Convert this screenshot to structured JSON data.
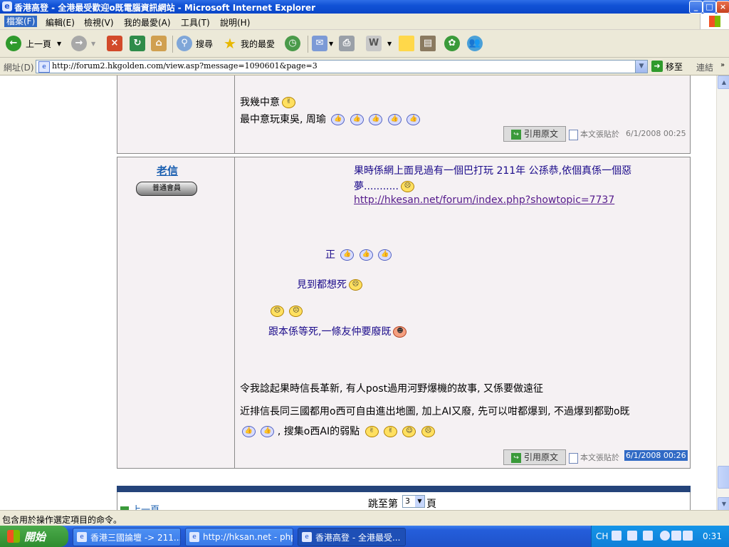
{
  "window": {
    "title": "香港高登 - 全港最受歡迎o既電腦資訊網站 - Microsoft Internet Explorer",
    "controls": [
      "_",
      "□",
      "×"
    ]
  },
  "menu": {
    "items": [
      "檔案(F)",
      "編輯(E)",
      "檢視(V)",
      "我的最愛(A)",
      "工具(T)",
      "說明(H)"
    ]
  },
  "toolbar": {
    "back_label": "上一頁",
    "search_label": "搜尋",
    "favorites_label": "我的最愛"
  },
  "address": {
    "label": "網址(D)",
    "url": "http://forum2.hkgolden.com/view.asp?message=1090601&page=3",
    "go_label": "移至",
    "links_label": "連結"
  },
  "posts": [
    {
      "lines": [
        "我幾中意",
        "最中意玩東吳, 周瑜"
      ],
      "quote_label": "引用原文",
      "posted_label": "本文張貼於",
      "timestamp": "6/1/2008 00:25"
    },
    {
      "author": "老信",
      "rank": "普通會員",
      "quote_text_1": "果時係網上面見過有一個巴打玩 211年 公孫恭,依個真係一個惡",
      "quote_text_2": "夢...........",
      "quote_link": "http://hkesan.net/forum/index.php?showtopic=7737",
      "nested_1": "正",
      "nested_2": "見到都想死",
      "nested_3": "跟本係等死,一條友仲要廢既",
      "body_1": "令我諗起果時信長革新, 有人post過用河野爆機的故事, 又係要做遠征",
      "body_2": "近排信長同三國都用o西可自由進出地圖, 加上AI又廢, 先可以咁都爆到, 不過爆到都勁o既",
      "body_3": ", 搜集o西AI的弱點",
      "quote_label": "引用原文",
      "posted_label": "本文張貼於",
      "timestamp": "6/1/2008 00:26"
    }
  ],
  "pager": {
    "prev_label": "上一頁",
    "jump_label": "跳至第",
    "page_value": "3",
    "page_suffix": "頁"
  },
  "status": {
    "text": "包含用於操作選定項目的命令。"
  },
  "taskbar": {
    "start_label": "開始",
    "tasks": [
      "香港三國論壇 -> 211...",
      "http://hksan.net - php...",
      "香港高登 - 全港最受..."
    ],
    "lang": "CH",
    "clock": "0:31"
  },
  "colors": {
    "titlebar": "#0a46c8",
    "link": "#551a8b",
    "nested_text": "#1a0a8a",
    "highlight": "#316ac5",
    "post_bg": "#f5f1f3",
    "navbar": "#24447a"
  }
}
